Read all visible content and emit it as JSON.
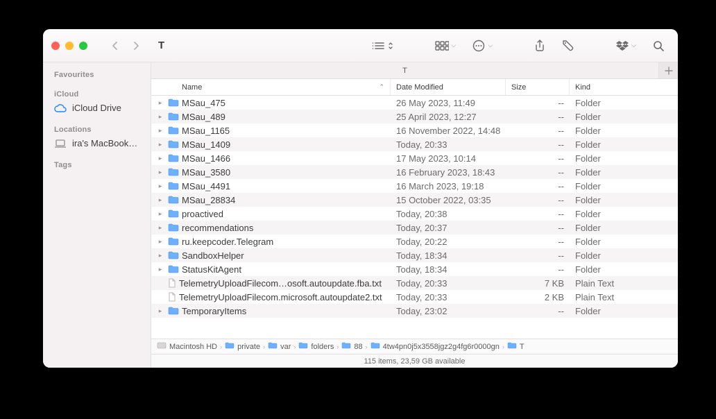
{
  "window_title": "T",
  "sidebar": {
    "favourites_label": "Favourites",
    "icloud_label": "iCloud",
    "icloud_drive": "iCloud Drive",
    "locations_label": "Locations",
    "macbook": "ira's MacBook…",
    "tags_label": "Tags"
  },
  "tab": {
    "label": "T"
  },
  "columns": {
    "name": "Name",
    "date": "Date Modified",
    "size": "Size",
    "kind": "Kind"
  },
  "files": [
    {
      "name": "MSau_475",
      "date": "26 May 2023, 11:49",
      "size": "--",
      "kind": "Folder",
      "folder": true
    },
    {
      "name": "MSau_489",
      "date": "25 April 2023, 12:27",
      "size": "--",
      "kind": "Folder",
      "folder": true
    },
    {
      "name": "MSau_1165",
      "date": "16 November 2022, 14:48",
      "size": "--",
      "kind": "Folder",
      "folder": true
    },
    {
      "name": "MSau_1409",
      "date": "Today, 20:33",
      "size": "--",
      "kind": "Folder",
      "folder": true
    },
    {
      "name": "MSau_1466",
      "date": "17 May 2023, 10:14",
      "size": "--",
      "kind": "Folder",
      "folder": true
    },
    {
      "name": "MSau_3580",
      "date": "16 February 2023, 18:43",
      "size": "--",
      "kind": "Folder",
      "folder": true
    },
    {
      "name": "MSau_4491",
      "date": "16 March 2023, 19:18",
      "size": "--",
      "kind": "Folder",
      "folder": true
    },
    {
      "name": "MSau_28834",
      "date": "15 October 2022, 03:35",
      "size": "--",
      "kind": "Folder",
      "folder": true
    },
    {
      "name": "proactived",
      "date": "Today, 20:38",
      "size": "--",
      "kind": "Folder",
      "folder": true
    },
    {
      "name": "recommendations",
      "date": "Today, 20:37",
      "size": "--",
      "kind": "Folder",
      "folder": true
    },
    {
      "name": "ru.keepcoder.Telegram",
      "date": "Today, 20:22",
      "size": "--",
      "kind": "Folder",
      "folder": true
    },
    {
      "name": "SandboxHelper",
      "date": "Today, 18:34",
      "size": "--",
      "kind": "Folder",
      "folder": true
    },
    {
      "name": "StatusKitAgent",
      "date": "Today, 18:34",
      "size": "--",
      "kind": "Folder",
      "folder": true
    },
    {
      "name": "TelemetryUploadFilecom…osoft.autoupdate.fba.txt",
      "date": "Today, 20:33",
      "size": "7 KB",
      "kind": "Plain Text",
      "folder": false
    },
    {
      "name": "TelemetryUploadFilecom.microsoft.autoupdate2.txt",
      "date": "Today, 20:33",
      "size": "2 KB",
      "kind": "Plain Text",
      "folder": false
    },
    {
      "name": "TemporaryItems",
      "date": "Today, 23:02",
      "size": "--",
      "kind": "Folder",
      "folder": true
    }
  ],
  "path": [
    {
      "label": "Macintosh HD",
      "type": "disk"
    },
    {
      "label": "private",
      "type": "folder"
    },
    {
      "label": "var",
      "type": "folder"
    },
    {
      "label": "folders",
      "type": "folder"
    },
    {
      "label": "88",
      "type": "folder"
    },
    {
      "label": "4tw4pn0j5x3558jgz2g4fg6r0000gn",
      "type": "folder"
    },
    {
      "label": "T",
      "type": "folder"
    }
  ],
  "status": "115 items, 23,59 GB available"
}
